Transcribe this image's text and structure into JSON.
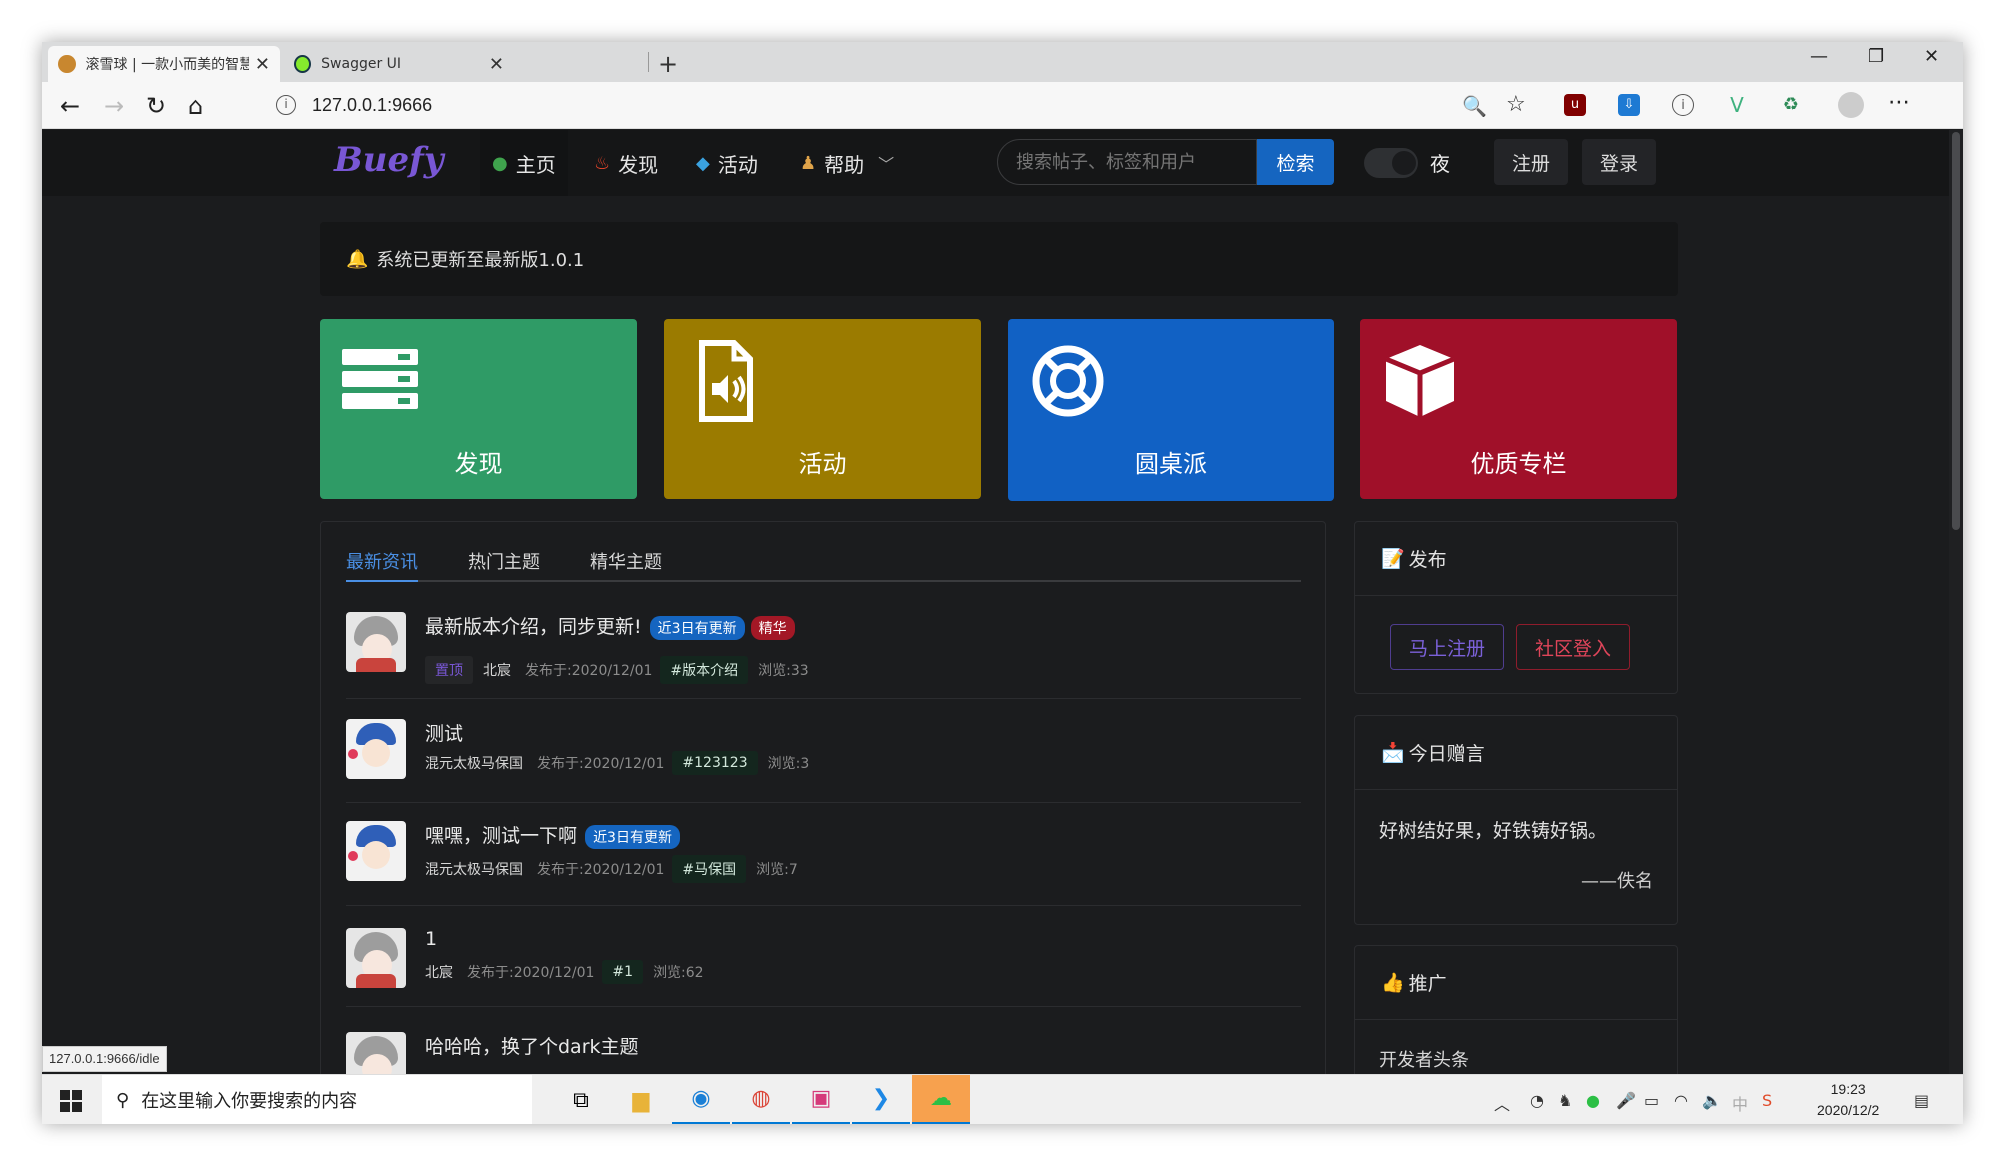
{
  "browser": {
    "tabs": [
      {
        "title": "滚雪球 | 一款小而美的智慧社区系",
        "active": true
      },
      {
        "title": "Swagger UI",
        "active": false
      }
    ],
    "new_tab_label": "+",
    "url": "127.0.0.1:9666",
    "status_url": "127.0.0.1:9666/idle"
  },
  "site": {
    "brand": "Buefy",
    "nav": [
      {
        "label": "主页",
        "icon": "globe-icon"
      },
      {
        "label": "发现",
        "icon": "fire-icon"
      },
      {
        "label": "活动",
        "icon": "whale-icon"
      },
      {
        "label": "帮助",
        "icon": "person-icon"
      }
    ],
    "search_placeholder": "搜索帖子、标签和用户",
    "search_button": "检索",
    "night_label": "夜",
    "register": "注册",
    "login": "登录"
  },
  "notice": "系统已更新至最新版1.0.1",
  "cards": [
    {
      "label": "发现",
      "icon": "server-icon",
      "color": "#2f9b66"
    },
    {
      "label": "活动",
      "icon": "audio-file-icon",
      "color": "#9b7b00"
    },
    {
      "label": "圆桌派",
      "icon": "lifebuoy-icon",
      "color": "#1161c4"
    },
    {
      "label": "优质专栏",
      "icon": "cube-icon",
      "color": "#a01029"
    }
  ],
  "feed": {
    "tabs": [
      "最新资讯",
      "热门主题",
      "精华主题"
    ],
    "posts": [
      {
        "title": "最新版本介绍，同步更新!",
        "badges": [
          "近3日有更新",
          "精华"
        ],
        "pinned": "置顶",
        "author": "北宸",
        "date": "发布于:2020/12/01",
        "tag": "#版本介绍",
        "views": "浏览:33",
        "avatar": "gray"
      },
      {
        "title": "测试",
        "badges": [],
        "pinned": "",
        "author": "混元太极马保国",
        "date": "发布于:2020/12/01",
        "tag": "#123123",
        "views": "浏览:3",
        "avatar": "blue"
      },
      {
        "title": "嘿嘿，测试一下啊",
        "badges": [
          "近3日有更新"
        ],
        "pinned": "",
        "author": "混元太极马保国",
        "date": "发布于:2020/12/01",
        "tag": "#马保国",
        "views": "浏览:7",
        "avatar": "blue"
      },
      {
        "title": "1",
        "badges": [],
        "pinned": "",
        "author": "北宸",
        "date": "发布于:2020/12/01",
        "tag": "#1",
        "views": "浏览:62",
        "avatar": "gray"
      },
      {
        "title": "哈哈哈，换了个dark主题",
        "badges": [],
        "pinned": "",
        "author": "",
        "date": "",
        "tag": "",
        "views": "",
        "avatar": "gray"
      }
    ]
  },
  "sidebar": {
    "publish": {
      "title": "发布",
      "register_btn": "马上注册",
      "login_btn": "社区登入"
    },
    "quote": {
      "title": "今日赠言",
      "text": "好树结好果，好铁铸好锅。",
      "author": "——佚名"
    },
    "promo": {
      "title": "推广",
      "item": "开发者头条"
    }
  },
  "taskbar": {
    "search_placeholder": "在这里输入你要搜索的内容",
    "time": "19:23",
    "date": "2020/12/2"
  }
}
